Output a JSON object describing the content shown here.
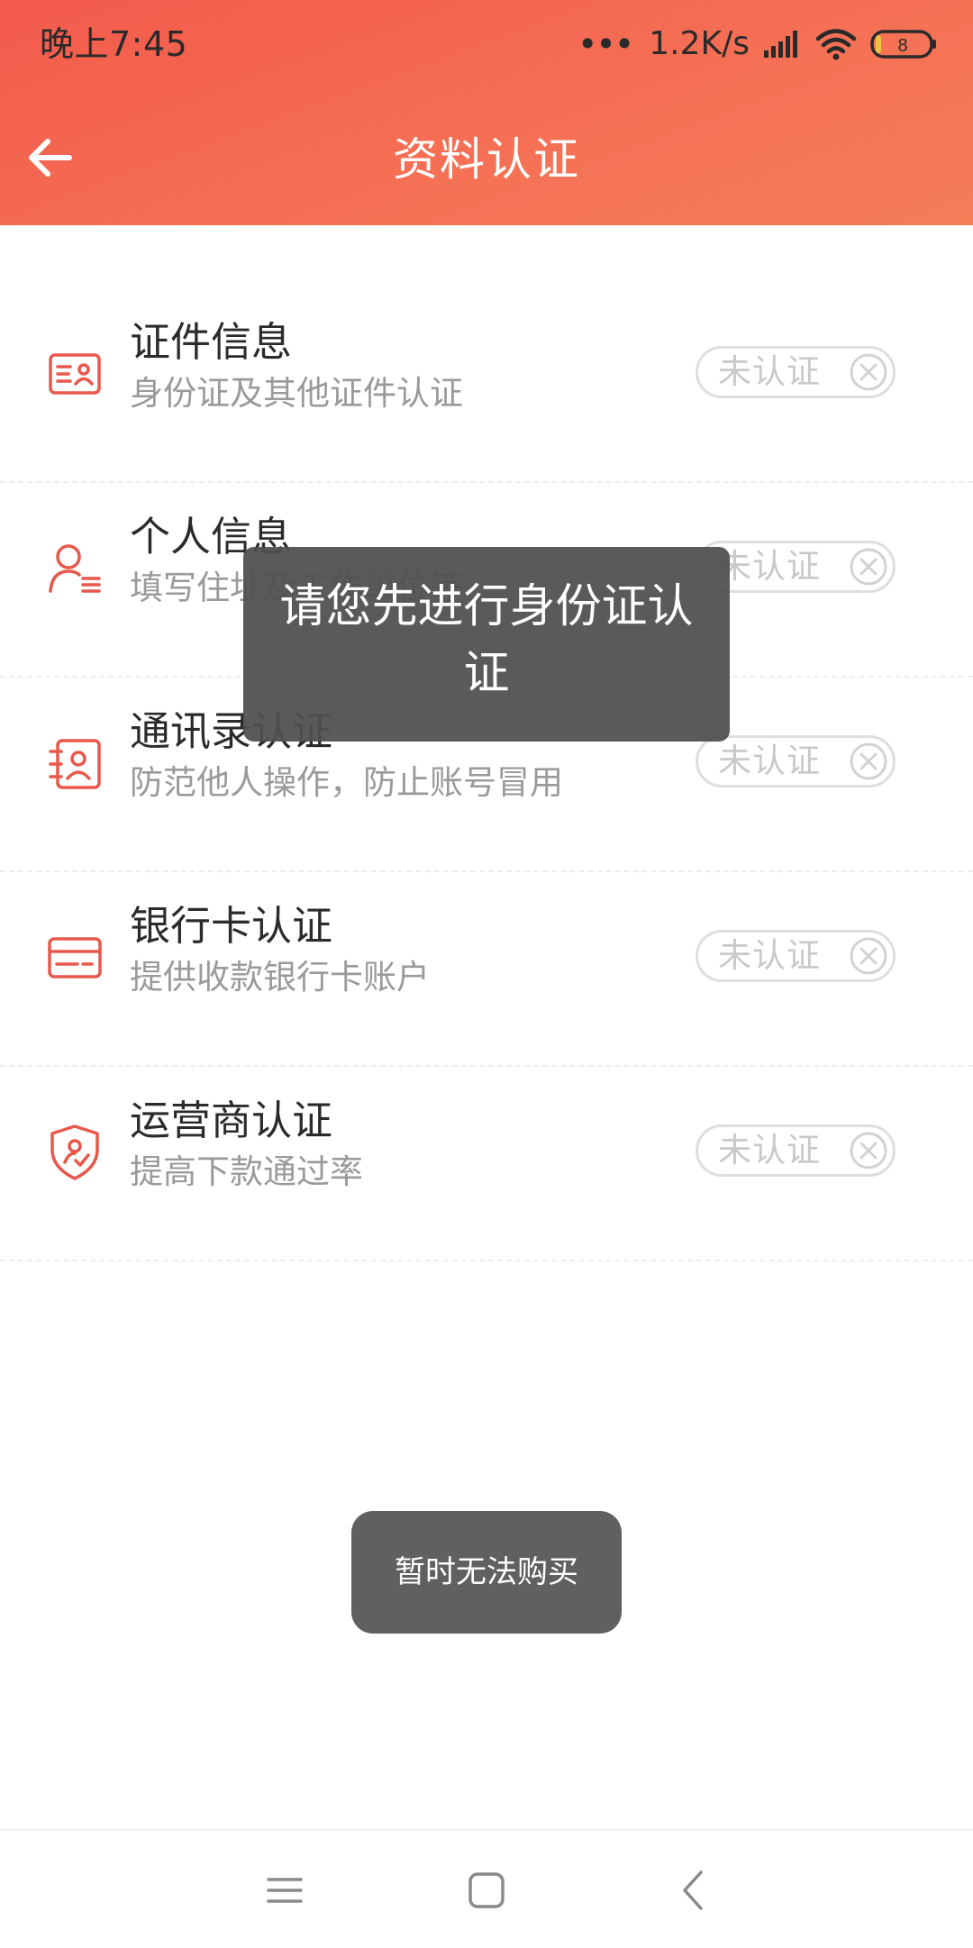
{
  "status_bar": {
    "time": "晚上7:45",
    "dots": "•••",
    "network_speed": "1.2K/s",
    "battery_level": "8"
  },
  "header": {
    "title": "资料认证"
  },
  "items": [
    {
      "title": "证件信息",
      "subtitle": "身份证及其他证件认证",
      "status": "未认证",
      "icon": "id-card-icon"
    },
    {
      "title": "个人信息",
      "subtitle": "填写住址及工作单位等",
      "status": "未认证",
      "icon": "person-info-icon"
    },
    {
      "title": "通讯录认证",
      "subtitle": "防范他人操作，防止账号冒用",
      "status": "未认证",
      "icon": "contacts-icon"
    },
    {
      "title": "银行卡认证",
      "subtitle": "提供收款银行卡账户",
      "status": "未认证",
      "icon": "bank-card-icon"
    },
    {
      "title": "运营商认证",
      "subtitle": "提高下款通过率",
      "status": "未认证",
      "icon": "carrier-shield-icon"
    }
  ],
  "toasts": {
    "identity_prompt": "请您先进行身份证认证",
    "purchase_unavailable": "暂时无法购买"
  },
  "colors": {
    "header_start": "#f35a4c",
    "header_end": "#f47d58",
    "icon_accent": "#e8584b",
    "badge_border": "#dedede",
    "badge_text": "#c9c9c9"
  }
}
